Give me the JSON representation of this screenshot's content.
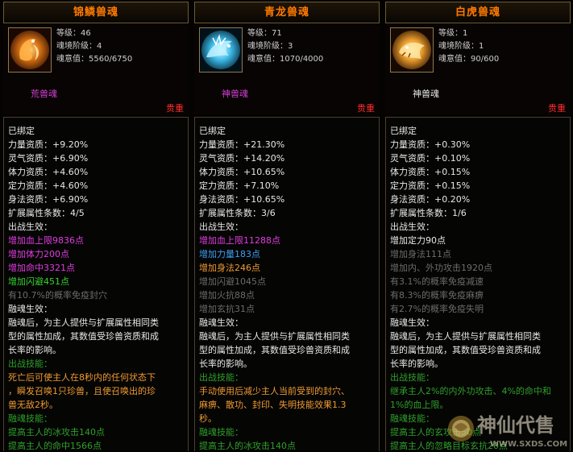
{
  "colors": {
    "title_orange": "#ff7a00",
    "kind_purple": "#d43fd4",
    "rare_red": "#ff2d2d",
    "green": "#36d42e",
    "pink": "#e03ce0",
    "blue": "#3c9ff6",
    "orange": "#f09a32",
    "grey": "#6c6c6c"
  },
  "cards": [
    {
      "title": "锦鳞兽魂",
      "icon": "golden-fish-soul-icon",
      "level": "等级：46",
      "tier": "魂境阶级：4",
      "soul_value": "魂意值：5560/6750",
      "kind": "荒兽魂",
      "rarity": "贵重",
      "bound": "已绑定",
      "stats": [
        "力量资质：+9.20%",
        "灵气资质：+6.90%",
        "体力资质：+4.60%",
        "定力资质：+4.60%",
        "身法资质：+6.90%"
      ],
      "ext_count": "扩展属性条数：4/5",
      "battle_effect_label": "出战生效：",
      "effects": [
        "增加血上限9836点",
        "增加体力200点",
        "增加命中3321点",
        "增加闪避451点",
        "有10.7%的概率免疫封穴"
      ],
      "fusion_label": "融魂生效：",
      "fusion_desc": [
        "融魂后，为主人提供与扩展属性相同类",
        "型的属性加成，其数值受珍兽资质和成",
        "长率的影响。"
      ],
      "skill_label": "出战技能：",
      "skill_desc": [
        "死亡后可使主人在8秒内的任何状态下",
        "，瞬发召唤1只珍兽，且使召唤出的珍",
        "兽无敌2秒。"
      ],
      "fusion_skill_label": "融魂技能：",
      "fusion_skills": [
        "提高主人的冰攻击140点",
        "提高主人的命中1566点"
      ]
    },
    {
      "title": "青龙兽魂",
      "icon": "azure-dragon-soul-icon",
      "level": "等级：71",
      "tier": "魂境阶级：3",
      "soul_value": "魂意值：1070/4000",
      "kind": "神兽魂",
      "rarity": "贵重",
      "bound": "已绑定",
      "stats": [
        "力量资质：+21.30%",
        "灵气资质：+14.20%",
        "体力资质：+10.65%",
        "定力资质：+7.10%",
        "身法资质：+10.65%"
      ],
      "ext_count": "扩展属性条数：3/6",
      "battle_effect_label": "出战生效：",
      "effects": [
        "增加血上限11288点",
        "增加力量183点",
        "增加身法246点",
        "增加闪避1045点",
        "增加火抗88点",
        "增加玄抗31点"
      ],
      "fusion_label": "融魂生效：",
      "fusion_desc": [
        "融魂后，为主人提供与扩展属性相同类",
        "型的属性加成，其数值受珍兽资质和成",
        "长率的影响。"
      ],
      "skill_label": "出战技能：",
      "skill_desc": [
        "手动使用后减少主人当前受到的封穴、",
        "麻痹、散功、封印、失明技能效果1.3",
        "秒。"
      ],
      "fusion_skill_label": "融魂技能：",
      "fusion_skills": [
        "提高主人的冰攻击140点"
      ]
    },
    {
      "title": "白虎兽魂",
      "icon": "white-tiger-soul-icon",
      "level": "等级：1",
      "tier": "魂境阶级：1",
      "soul_value": "魂意值：90/600",
      "kind": "神兽魂",
      "rarity": "贵重",
      "bound": "已绑定",
      "stats": [
        "力量资质：+0.30%",
        "灵气资质：+0.10%",
        "体力资质：+0.15%",
        "定力资质：+0.15%",
        "身法资质：+0.20%"
      ],
      "ext_count": "扩展属性条数：1/6",
      "battle_effect_label": "出战生效：",
      "effects": [
        "增加定力90点",
        "增加身法111点",
        "增加内、外功攻击1920点",
        "有3.1%的概率免疫减速",
        "有8.3%的概率免疫麻痹",
        "有2.7%的概率免疫失明"
      ],
      "fusion_label": "融魂生效：",
      "fusion_desc": [
        "融魂后，为主人提供与扩展属性相同类",
        "型的属性加成，其数值受珍兽资质和成",
        "长率的影响。"
      ],
      "skill_label": "出战技能：",
      "skill_desc": [
        "继承主人2%的内外功攻击、4%的命中和",
        "1%的血上限。"
      ],
      "fusion_skill_label": "融魂技能：",
      "fusion_skills": [
        "提高主人的玄攻击50点",
        "提高主人的忽略目标玄抗20点"
      ]
    }
  ],
  "watermark": {
    "brand": "神仙代售",
    "url": "WWW.SXDS.COM"
  }
}
